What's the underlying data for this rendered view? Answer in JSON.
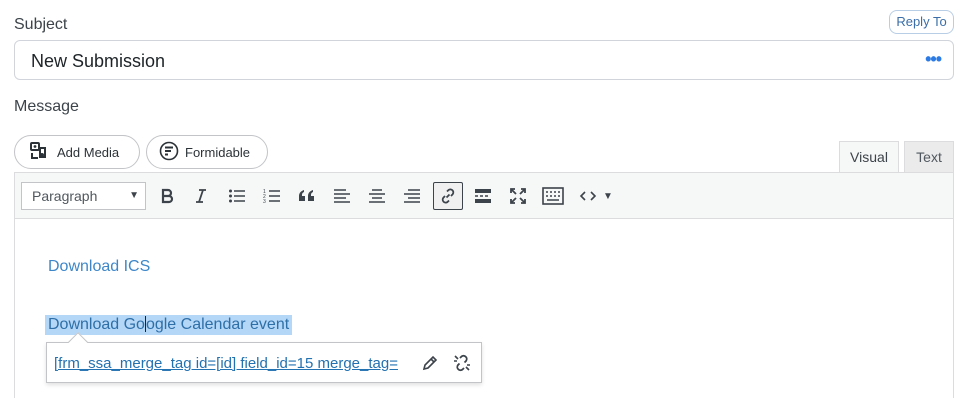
{
  "subject": {
    "label": "Subject",
    "reply_to_label": "Reply To",
    "value": "New Submission",
    "more_icon": "more-dots-icon"
  },
  "message": {
    "label": "Message",
    "add_media_label": "Add Media",
    "formidable_label": "Formidable",
    "tabs": [
      {
        "label": "Visual",
        "active": true
      },
      {
        "label": "Text",
        "active": false
      }
    ]
  },
  "toolbar": {
    "format_select": "Paragraph",
    "buttons": [
      {
        "name": "bold-icon"
      },
      {
        "name": "italic-icon"
      },
      {
        "name": "bullet-list-icon"
      },
      {
        "name": "numbered-list-icon"
      },
      {
        "name": "blockquote-icon"
      },
      {
        "name": "align-left-icon"
      },
      {
        "name": "align-center-icon"
      },
      {
        "name": "align-right-icon"
      },
      {
        "name": "link-icon",
        "active": true
      },
      {
        "name": "read-more-icon"
      },
      {
        "name": "fullscreen-icon"
      },
      {
        "name": "toolbar-toggle-icon"
      },
      {
        "name": "code-icon"
      }
    ]
  },
  "content": {
    "link1": "Download ICS",
    "link2_before": "Download Go",
    "link2_after": "ogle Calendar event"
  },
  "link_popup": {
    "url": "[frm_ssa_merge_tag id=[id] field_id=15 merge_tag="
  },
  "colors": {
    "link": "#3d87c9",
    "selection": "#b4d7f7",
    "accent": "#2c7be5"
  }
}
